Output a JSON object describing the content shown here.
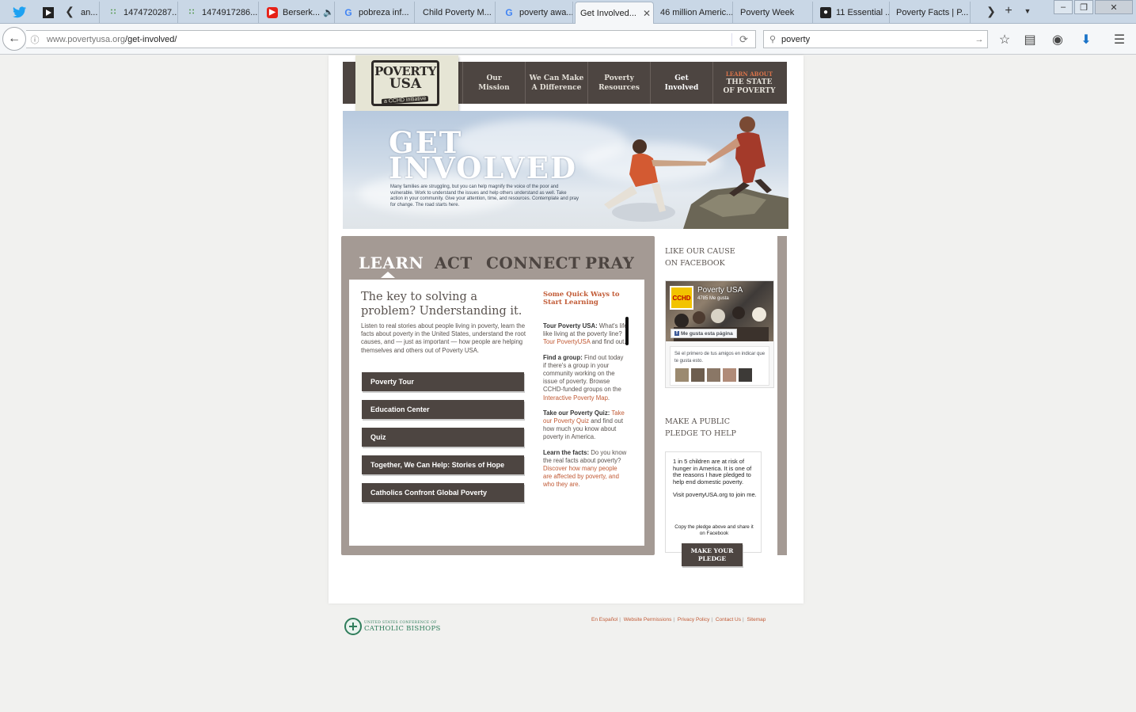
{
  "browser": {
    "tabs": [
      {
        "label": "an...",
        "icon": "play-icon"
      },
      {
        "label": "1474720287...",
        "icon": "grid-icon"
      },
      {
        "label": "1474917286...",
        "icon": "grid-icon"
      },
      {
        "label": "Berserk...",
        "icon": "youtube-icon"
      },
      {
        "label": "pobreza inf...",
        "icon": "google-icon"
      },
      {
        "label": "Child Poverty M...",
        "icon": "blank-icon"
      },
      {
        "label": "poverty awa...",
        "icon": "google-icon"
      },
      {
        "label": "Get Involved...",
        "icon": "blank-icon",
        "active": true
      },
      {
        "label": "46 million Americ...",
        "icon": "blank-icon"
      },
      {
        "label": "Poverty Week",
        "icon": "blank-icon"
      },
      {
        "label": "11 Essential ...",
        "icon": "camera-icon"
      },
      {
        "label": "Poverty Facts | P...",
        "icon": "blank-icon"
      }
    ],
    "url_host": "www.povertyusa.org",
    "url_path": "/get-involved/",
    "search_value": "poverty"
  },
  "site": {
    "logo": {
      "line1": "POVERTY",
      "line2": "USA",
      "tagline": "a CCHD initiative"
    },
    "nav": [
      {
        "line1": "Our",
        "line2": "Mission"
      },
      {
        "line1": "We Can Make",
        "line2": "A Difference"
      },
      {
        "line1": "Poverty",
        "line2": "Resources"
      },
      {
        "line1": "Get",
        "line2": "Involved"
      },
      {
        "small": "LEARN ABOUT",
        "line1": "THE STATE",
        "line2": "OF POVERTY"
      }
    ],
    "hero": {
      "title_line1": "GET",
      "title_line2": "INVOLVED",
      "text": "Many families are struggling, but you can help magnify the voice of the poor and vulnerable. Work to understand the issues and help others understand as well. Take action in your community. Give your attention, time, and resources. Contemplate and pray for change. The road starts here."
    },
    "content_tabs": [
      "LEARN",
      "ACT",
      "CONNECT",
      "PRAY"
    ],
    "learn": {
      "heading": "The key to solving a problem? Understanding it.",
      "body": "Listen to real stories about people living in poverty, learn the facts about poverty in the United States, understand the root causes, and — just as important — how people are helping themselves and others out of Poverty USA.",
      "buttons": [
        "Poverty Tour",
        "Education Center",
        "Quiz",
        "Together, We Can Help: Stories of Hope",
        "Catholics Confront Global Poverty"
      ]
    },
    "quick": {
      "title": "Some Quick Ways to Start Learning",
      "items": [
        {
          "label": "Tour Poverty USA:",
          "text": " What's life like living at the poverty line? ",
          "link": "Tour PovertyUSA",
          "after": " and find out."
        },
        {
          "label": "Find a group:",
          "text": " Find out today if there's a group in your community working on the issue of poverty. Browse CCHD-funded groups on the ",
          "link": "Interactive Poverty Map",
          "after": "."
        },
        {
          "label": "Take our Poverty Quiz:",
          "text": " ",
          "link": "Take our Poverty Quiz",
          "after": " and find out how much you know about poverty in America."
        },
        {
          "label": "Learn the facts:",
          "text": " Do you know the real facts about poverty? ",
          "link": "Discover how many people are affected by poverty, and who they are",
          "after": "."
        }
      ]
    },
    "sidebar": {
      "fb_heading_1": "LIKE OUR CAUSE",
      "fb_heading_2": "ON FACEBOOK",
      "fb_thumb": "CCHD",
      "fb_page_name": "Poverty USA",
      "fb_likes": "4785 Me gusta",
      "fb_like_button": "Me gusta esta página",
      "fb_friends_text": "Sé el primero de tus amigos en indicar que te gusta esto.",
      "pledge_heading_1": "MAKE A PUBLIC",
      "pledge_heading_2": "PLEDGE TO HELP",
      "pledge_text_1": "1 in 5 children are at risk of hunger in America. It is one of the reasons I have pledged to help end domestic poverty.",
      "pledge_text_2": "Visit povertyUSA.org to join me.",
      "pledge_copy": "Copy the pledge above and share it on Facebook",
      "pledge_button_1": "MAKE YOUR",
      "pledge_button_2": "PLEDGE"
    },
    "footer": {
      "org_line1": "UNITED STATES CONFERENCE OF",
      "org_line2": "CATHOLIC BISHOPS",
      "links": [
        "En Español",
        "Website Permissions",
        "Privacy Policy",
        "Contact Us",
        "Sitemap"
      ]
    }
  },
  "colors": {
    "brand_dark": "#4d4541",
    "accent": "#c15a35",
    "panel": "#a49a94"
  }
}
